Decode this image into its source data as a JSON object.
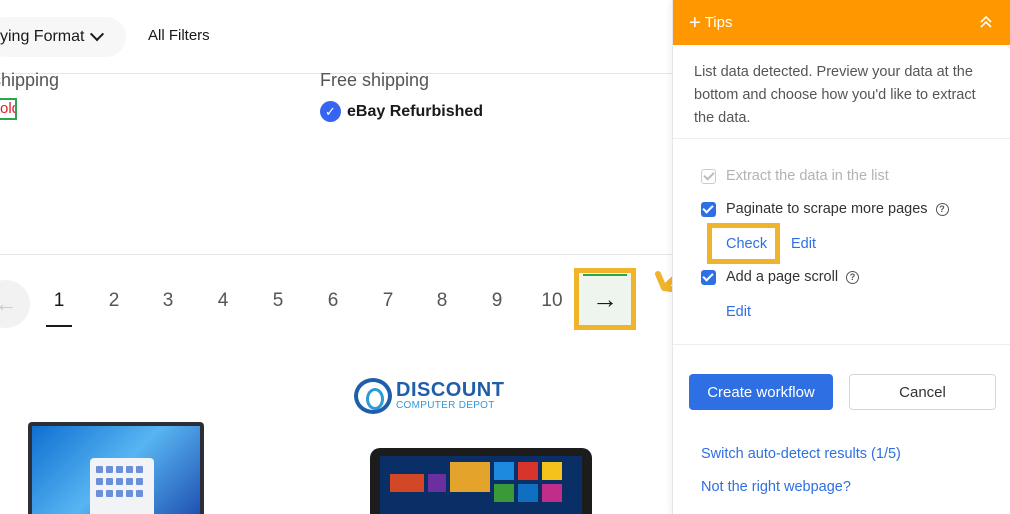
{
  "page": {
    "filters": {
      "buying_format_label": "ying Format",
      "all_filters_label": "All Filters"
    },
    "items": [
      {
        "shipping": "shipping",
        "badge": "old"
      },
      {
        "shipping": "Free shipping",
        "refurb_label": "eBay Refurbished"
      }
    ],
    "pagination": {
      "prev_label": "←",
      "pages": [
        "1",
        "2",
        "3",
        "4",
        "5",
        "6",
        "7",
        "8",
        "9",
        "10"
      ],
      "active_page": "1",
      "next_label": "→"
    },
    "seller_logo": {
      "line1": "DISCOUNT",
      "line2": "COMPUTER DEPOT"
    }
  },
  "panel": {
    "header": {
      "title": "Tips",
      "plus_icon": "+"
    },
    "description": "List data detected. Preview your data at the bottom and choose how you'd like to extract the data.",
    "options": [
      {
        "label": "Extract the data in the list",
        "checked": true,
        "disabled": true
      },
      {
        "label": "Paginate to scrape more pages",
        "checked": true,
        "disabled": false,
        "help_icon": "?"
      },
      {
        "label": "Add a page scroll",
        "checked": true,
        "disabled": false,
        "help_icon": "?"
      }
    ],
    "paginate_links": {
      "check": "Check",
      "edit": "Edit"
    },
    "scroll_links": {
      "edit": "Edit"
    },
    "buttons": {
      "create": "Create workflow",
      "cancel": "Cancel"
    },
    "bottom_links": {
      "switch": "Switch auto-detect results (1/5)",
      "wrong_page": "Not the right webpage?"
    },
    "colors": {
      "header": "#ff9800",
      "primary": "#2f6fe4",
      "highlight": "#f0b32c"
    }
  }
}
